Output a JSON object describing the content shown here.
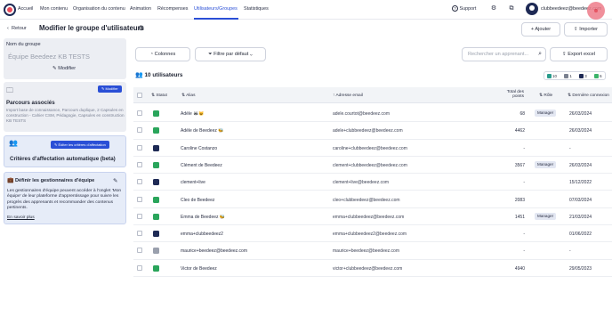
{
  "nav": {
    "items": [
      "Accueil",
      "Mon contenu",
      "Organisation du contenu",
      "Animation",
      "Récompenses",
      "Utilisateurs/Groupes",
      "Statistiques"
    ],
    "support": "Support",
    "username": "clubbeedeez@beedeez.com"
  },
  "header": {
    "back": "Retour",
    "title": "Modifier le groupe d'utilisateurs",
    "add": "Ajouter",
    "import": "Importer"
  },
  "toolbar": {
    "columns": "Colonnes",
    "filter": "Filtre par défaut",
    "search_placeholder": "Rechercher un apprenant...",
    "export": "Export excel"
  },
  "sidebar": {
    "name_label": "Nom du groupe",
    "name_value": "Équipe Beedeez KB TESTS",
    "modify": "Modifier",
    "paths_title": "Parcours associés",
    "paths_badge": "Modifier",
    "paths_text": "Import base de connaissance, Parcours duplique, 2 Capsules en construction - Cahier CSM, Pédagogie, Capsules en construction KB TESTS",
    "criteria_button": "Éditer les critères d'affectation",
    "criteria_title": "Critères d'affectation automatique (beta)",
    "managers_title": "Définir les gestionnaires d'équipe",
    "managers_text": "Les gestionnaires d'équipe peuvent accéder à l'onglet 'Mon équipe' de leur plateforme d'apprentissage pour suivre les progrès des apprenants et recommander des contenus pertinents.",
    "learn_more": "En savoir plus"
  },
  "users": {
    "count_label": "10 utilisateurs",
    "badges": [
      {
        "count": "10",
        "color": "#2a9c8c"
      },
      {
        "count": "1",
        "color": "#7b8190"
      },
      {
        "count": "3",
        "color": "#1e2a55"
      },
      {
        "count": "6",
        "color": "#3bb36a"
      }
    ],
    "columns": {
      "status": "Statut",
      "alias": "Alias",
      "email": "Adresse email",
      "points": "Total des points",
      "role": "Rôle",
      "last": "Dernière connexion"
    },
    "rows": [
      {
        "alias": "Adèle 🦝😺",
        "email": "adele.courtot@beedeez.com",
        "points": "68",
        "role": "Manager",
        "last": "26/03/2024",
        "status": "#2aa55b"
      },
      {
        "alias": "Adèle de Beedeez 🐝",
        "email": "adele+clubbeedeez@beedeez.com",
        "points": "4462",
        "role": "",
        "last": "26/03/2024",
        "status": "#2aa55b"
      },
      {
        "alias": "Caroline Costanzo",
        "email": "caroline+clubbeedeez@beedeez.com",
        "points": "-",
        "role": "",
        "last": "-",
        "status": "#1e2a55"
      },
      {
        "alias": "Clément de Beedeez",
        "email": "clement+clubbeedeez@beedeez.com",
        "points": "3567",
        "role": "Manager",
        "last": "26/03/2024",
        "status": "#2aa55b"
      },
      {
        "alias": "clement+live",
        "email": "clement+live@beedeez.com",
        "points": "-",
        "role": "",
        "last": "15/12/2022",
        "status": "#1e2a55"
      },
      {
        "alias": "Cleo de Beedeez",
        "email": "cleo+clubbeedeez@beedeez.com",
        "points": "2083",
        "role": "",
        "last": "07/03/2024",
        "status": "#2aa55b"
      },
      {
        "alias": "Emma de Beedeez 🐝",
        "email": "emma+clubbeedeez@beedeez.com",
        "points": "1451",
        "role": "Manager",
        "last": "21/03/2024",
        "status": "#2aa55b"
      },
      {
        "alias": "emma+clubbeedeez2",
        "email": "emma+clubbeedeez2@beedeez.com",
        "points": "-",
        "role": "",
        "last": "01/06/2022",
        "status": "#1e2a55"
      },
      {
        "alias": "maurice+beedeez@beedeez.com",
        "email": "maurice+beedeez@beedeez.com",
        "points": "-",
        "role": "",
        "last": "-",
        "status": "#9aa0ad"
      },
      {
        "alias": "Victor de Beedeez",
        "email": "victor+clubbeedeez@beedeez.com",
        "points": "4940",
        "role": "",
        "last": "29/05/2023",
        "status": "#2aa55b"
      }
    ]
  },
  "colors": {
    "accent": "#2a4fd6",
    "active_status": "#2aa55b",
    "pending_status": "#1e2a55"
  }
}
